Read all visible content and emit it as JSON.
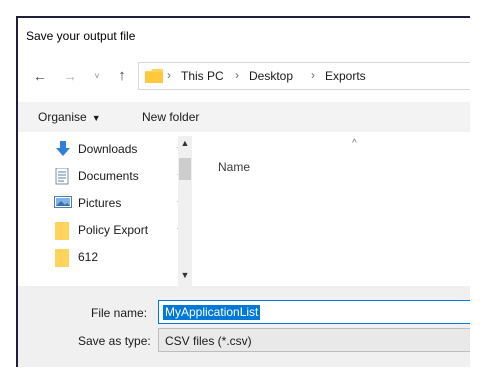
{
  "window": {
    "title": "Save your output file"
  },
  "navigation": {
    "back_glyph": "←",
    "forward_glyph": "→",
    "recent_glyph": "˅",
    "up_glyph": "↑"
  },
  "address": {
    "icon": "folder-icon",
    "separator": "›",
    "crumbs": [
      "This PC",
      "Desktop",
      "Exports"
    ]
  },
  "toolbar": {
    "organise_label": "Organise",
    "organise_caret": "▼",
    "new_folder_label": "New folder"
  },
  "sidebar": {
    "items": [
      {
        "label": "Downloads",
        "icon": "download-arrow-icon",
        "pinned": true
      },
      {
        "label": "Documents",
        "icon": "document-icon",
        "pinned": true
      },
      {
        "label": "Pictures",
        "icon": "pictures-icon",
        "pinned": true
      },
      {
        "label": "Policy Export",
        "icon": "folder-icon",
        "pinned": true
      },
      {
        "label": "612",
        "icon": "folder-icon",
        "pinned": false
      }
    ],
    "pin_glyph": "📌"
  },
  "file_list": {
    "column_header": "Name",
    "sort_glyph": "^"
  },
  "form": {
    "file_name_label": "File name:",
    "file_name_value": "MyApplicationList",
    "save_as_type_label": "Save as type:",
    "save_as_type_value": "CSV files (*.csv)"
  },
  "colors": {
    "selection": "#0078d7",
    "folder": "#ffd35c",
    "download_arrow": "#2f7fd6",
    "toolbar_bg": "#f3f3f3",
    "bottom_bg": "#f0f0f0"
  }
}
